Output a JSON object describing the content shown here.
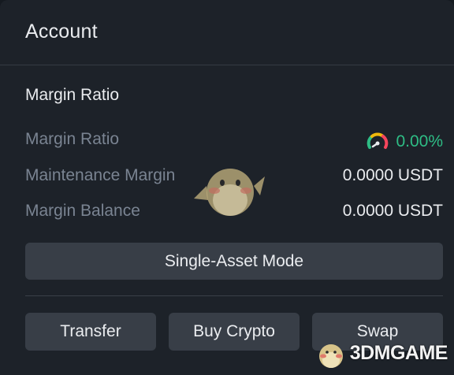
{
  "header": {
    "title": "Account"
  },
  "margin": {
    "section_title": "Margin Ratio",
    "rows": [
      {
        "label": "Margin Ratio",
        "value": "0.00%"
      },
      {
        "label": "Maintenance Margin",
        "value": "0.0000 USDT"
      },
      {
        "label": "Margin Balance",
        "value": "0.0000 USDT"
      }
    ]
  },
  "mode_button": {
    "label": "Single-Asset Mode"
  },
  "actions": {
    "transfer": "Transfer",
    "buy_crypto": "Buy Crypto",
    "swap": "Swap"
  },
  "watermark": {
    "text": "3DMGAME"
  },
  "colors": {
    "background": "#1d2229",
    "button": "#383e47",
    "label": "#7a8492",
    "text": "#eaecef",
    "positive": "#2ebd85"
  },
  "icons": {
    "gauge": "margin-ratio-gauge-icon",
    "mascot": "mascot-watermark-icon"
  }
}
